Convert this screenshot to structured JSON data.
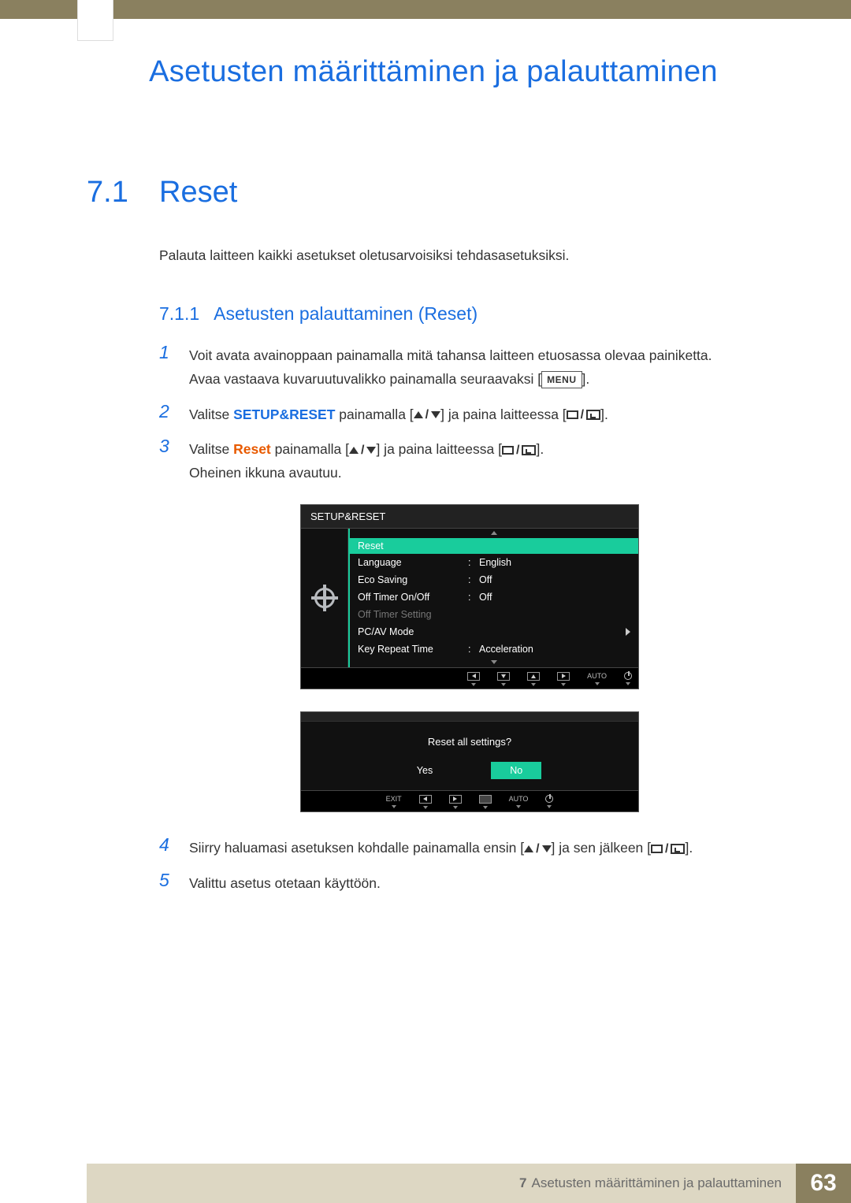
{
  "chapter_header": "Asetusten määrittäminen ja palauttaminen",
  "section": {
    "num": "7.1",
    "title": "Reset"
  },
  "intro": "Palauta laitteen kaikki asetukset oletusarvoisiksi tehdasasetuksiksi.",
  "subsection": {
    "num": "7.1.1",
    "title": "Asetusten palauttaminen (Reset)"
  },
  "menu_label": "MENU",
  "steps": {
    "s1a": "Voit avata avainoppaan painamalla mitä tahansa laitteen etuosassa olevaa painiketta.",
    "s1b_pre": "Avaa vastaava kuvaruutuvalikko painamalla seuraavaksi [",
    "s1b_post": "].",
    "s2_pre": "Valitse ",
    "s2_setup": "SETUP&RESET",
    "s2_mid1": " painamalla [",
    "s2_mid2": "] ja paina laitteessa [",
    "s2_post": "].",
    "s3_pre": "Valitse ",
    "s3_reset": "Reset",
    "s3_mid1": " painamalla [",
    "s3_mid2": "] ja paina laitteessa [",
    "s3_post": "].",
    "s3_extra": "Oheinen ikkuna avautuu.",
    "s4_pre": "Siirry haluamasi asetuksen kohdalle painamalla ensin [",
    "s4_mid": "] ja sen jälkeen [",
    "s4_post": "].",
    "s5": "Valittu asetus otetaan käyttöön."
  },
  "osd": {
    "title": "SETUP&RESET",
    "rows": [
      {
        "label": "Reset",
        "val": "",
        "hl": true
      },
      {
        "label": "Language",
        "val": "English"
      },
      {
        "label": "Eco Saving",
        "val": "Off"
      },
      {
        "label": "Off Timer On/Off",
        "val": "Off"
      },
      {
        "label": "Off Timer Setting",
        "val": "",
        "dim": true
      },
      {
        "label": "PC/AV Mode",
        "val": "",
        "caret": true
      },
      {
        "label": "Key Repeat Time",
        "val": "Acceleration"
      }
    ],
    "footer_auto": "AUTO"
  },
  "dialog": {
    "question": "Reset all settings?",
    "yes": "Yes",
    "no": "No",
    "exit": "EXIT",
    "auto": "AUTO"
  },
  "footer": {
    "chap_num": "7",
    "chap_text": "Asetusten määrittäminen ja palauttaminen",
    "page_num": "63"
  }
}
